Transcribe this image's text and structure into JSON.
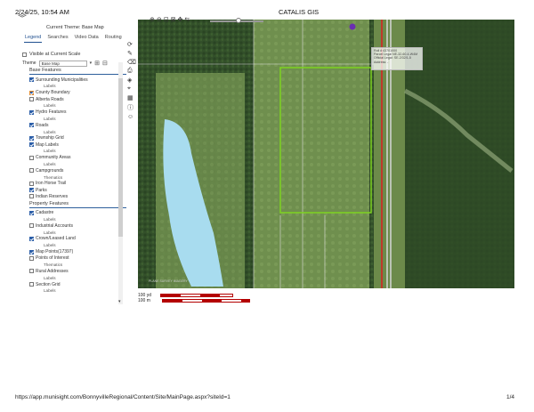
{
  "header": {
    "datetime": "2/24/25, 10:54 AM",
    "title": "CATALIS GIS"
  },
  "footer": {
    "url": "https://app.munisight.com/BonnyvilleRegional/Content/Site/MainPage.aspx?siteId=1",
    "page": "1/4"
  },
  "panel": {
    "current_theme_label": "Current Theme: Base Map",
    "tabs": [
      {
        "label": "Legend",
        "active": true
      },
      {
        "label": "Searches",
        "active": false
      },
      {
        "label": "Video Data",
        "active": false
      },
      {
        "label": "Routing",
        "active": false
      }
    ],
    "visible_label": "Visible at Current Scale",
    "theme_label": "Theme",
    "theme_value": "Base Map",
    "sections": [
      {
        "header": "Base Features",
        "items": [
          {
            "label": "Surrounding Municipalities",
            "checked": true,
            "sub": "Labels"
          },
          {
            "label": "County Boundary",
            "checked": true,
            "sub": "",
            "orange": true
          },
          {
            "label": "Alberta Roads",
            "checked": false,
            "sub": "Labels"
          },
          {
            "label": "Hydro Features",
            "checked": true,
            "sub": "Labels"
          },
          {
            "label": "Roads",
            "checked": true,
            "sub": "Labels"
          },
          {
            "label": "Township Grid",
            "checked": true,
            "sub": ""
          },
          {
            "label": "Map Labels",
            "checked": true,
            "sub": "Labels"
          },
          {
            "label": "Community Areas",
            "checked": false,
            "sub": "Labels"
          },
          {
            "label": "Campgrounds",
            "checked": false,
            "sub": "Thematics"
          },
          {
            "label": "Iron Horse Trail",
            "checked": false,
            "sub": ""
          },
          {
            "label": "Parks",
            "checked": true,
            "sub": ""
          },
          {
            "label": "Indian Reserves",
            "checked": false,
            "sub": ""
          }
        ]
      },
      {
        "header": "Property Features",
        "items": [
          {
            "label": "Cadastre",
            "checked": true,
            "sub": "Labels"
          },
          {
            "label": "Industrial Accounts",
            "checked": false,
            "sub": "Labels"
          },
          {
            "label": "Crown/Leased Land",
            "checked": true,
            "sub": "Labels"
          },
          {
            "label": "Map Points(17397)",
            "checked": true,
            "sub": ""
          },
          {
            "label": "Points of Interest",
            "checked": false,
            "sub": "Thematics"
          },
          {
            "label": "Rural Addresses",
            "checked": false,
            "sub": "Labels"
          },
          {
            "label": "Section Grid",
            "checked": false,
            "sub": "Labels"
          }
        ]
      }
    ]
  },
  "map": {
    "popup_lines": [
      "Roll # 43701000",
      "Parcel Legal NE-32-60-4-W4M",
      "Official Legal: SE-2/32/1-5",
      "Address: -"
    ],
    "watermark": "PLANE SURVEY  IMAGERY",
    "scale": [
      {
        "label": "100 yd"
      },
      {
        "label": "100 m"
      }
    ]
  },
  "colors": {
    "parcel_outline": "#7ed321",
    "highway": "#c0392b",
    "lake": "#a8dcef",
    "accent": "#2b5ea8"
  }
}
